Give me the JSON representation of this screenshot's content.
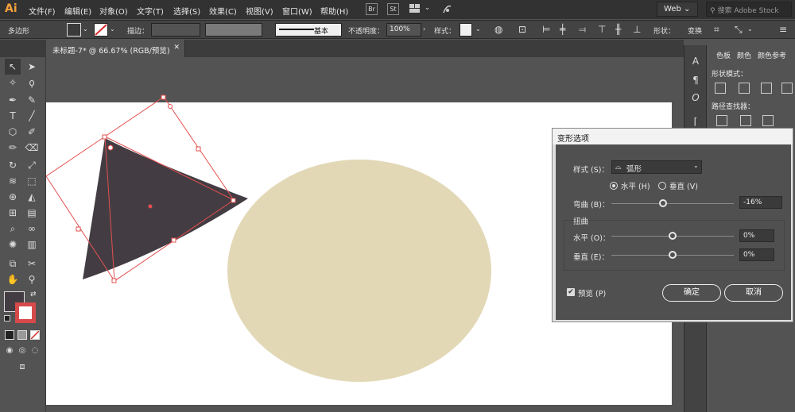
{
  "app": {
    "logo": "Ai",
    "accent": "#f7a13d"
  },
  "menu": [
    "文件(F)",
    "编辑(E)",
    "对象(O)",
    "文字(T)",
    "选择(S)",
    "效果(C)",
    "视图(V)",
    "窗口(W)",
    "帮助(H)"
  ],
  "topbar": {
    "bridge": "Br",
    "stock_icon": "St",
    "workspace": "Web",
    "search_placeholder": "搜索 Adobe Stock"
  },
  "control": {
    "object_type": "多边形",
    "stroke_label": "描边：",
    "brush_label": "基本",
    "opacity_label": "不透明度：",
    "opacity_value": "100%",
    "style_label": "样式：",
    "shape_label": "形状：",
    "transform_label": "变换"
  },
  "document_tab": {
    "title": "未标题-7* @ 66.67% (RGB/预览)"
  },
  "panel": {
    "tabs": [
      "色板",
      "颜色",
      "颜色参考"
    ],
    "shape_modes": "形状模式：",
    "pathfinder": "路径查找器："
  },
  "canvas": {
    "shape_fill": "#433d43",
    "ellipse_fill": "#e3d8b6",
    "selection_color": "#e34f4f"
  },
  "warp_dialog": {
    "title": "变形选项",
    "style_label": "样式 (S)：",
    "style_value": "弧形",
    "horizontal_radio": "水平 (H)",
    "vertical_radio": "垂直 (V)",
    "horizontal_selected": true,
    "bend_label": "弯曲 (B)：",
    "bend_value": "-16%",
    "bend_fraction": 0.42,
    "distortion_label": "扭曲",
    "h_label": "水平 (O)：",
    "h_value": "0%",
    "v_label": "垂直 (E)：",
    "v_value": "0%",
    "preview_label": "预览 (P)",
    "preview_checked": true,
    "ok_label": "确定",
    "cancel_label": "取消"
  }
}
